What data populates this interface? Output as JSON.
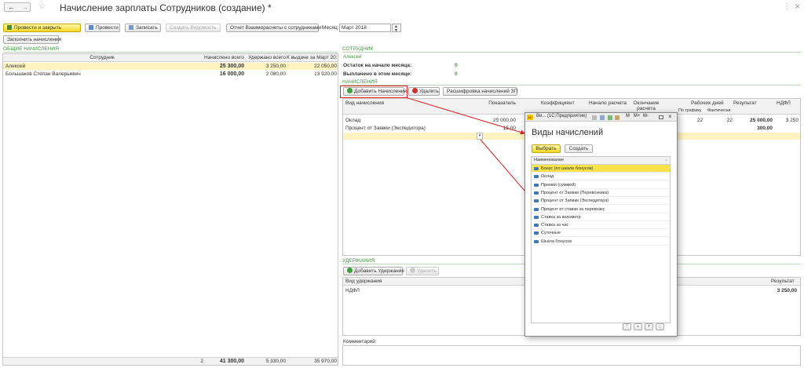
{
  "window": {
    "title": "Начисление зарплаты Сотрудников (создание) *",
    "nav_back": "←",
    "nav_forward": "→",
    "star": "☆",
    "more": "⋮",
    "close": "×"
  },
  "toolbar": {
    "post_close": "Провести и закрыть",
    "post": "Провести",
    "save": "Записать",
    "create_statement": "Создать Ведомость",
    "report_settlements": "Отчет Взаиморасчеты с сотрудниками",
    "month_label": "Месяц:",
    "month_value": "Март 2018",
    "fill_accruals": "Заполнить начисления"
  },
  "general": {
    "section_title": "ОБЩИЕ НАЧИСЛЕНИЯ",
    "columns": [
      "Сотрудник",
      "Начислено всего",
      "Удержано всего",
      "К выдаче за Март 2018"
    ],
    "rows": [
      {
        "employee": "Алексей",
        "accrued": "25 300,00",
        "withheld": "3 250,00",
        "payout": "22 050,00"
      },
      {
        "employee": "Большаков Степан Валерьевич",
        "accrued": "16 000,00",
        "withheld": "2 080,00",
        "payout": "13 920,00"
      }
    ],
    "footer": {
      "count": "2",
      "accrued": "41 300,00",
      "withheld": "5 330,00",
      "payout": "35 970,00"
    }
  },
  "employee": {
    "section_title": "СОТРУДНИК",
    "name": "Алексей",
    "balance_label": "Остаток на начало месяца:",
    "balance_value": "0",
    "paid_label": "Выплачено в этом месяце:",
    "paid_value": "0"
  },
  "accruals": {
    "section_title": "НАЧИСЛЕНИЯ",
    "add_button": "Добавить Начисление",
    "delete_button": "Удалить",
    "breakdown_button": "Расшифровка начислений ЗП",
    "columns": {
      "type": "Вид начисления",
      "indicator": "Показатель",
      "coefficient": "Коэффициент",
      "start": "Начало расчета",
      "end": "Окончание расчета",
      "workdays": "Рабочих дней",
      "by_schedule": "По графику",
      "actual": "Фактически",
      "result": "Результат",
      "ndfl": "НДФЛ"
    },
    "rows": [
      {
        "type": "Оклад",
        "indicator": "25 000,00",
        "by_schedule": "22",
        "actual": "22",
        "result": "25 000,00",
        "ndfl": "3 250"
      },
      {
        "type": "Процент от Заявки (Экспедитора)",
        "indicator": "15,00",
        "by_schedule": "",
        "actual": "",
        "result": "300,00",
        "ndfl": ""
      }
    ]
  },
  "deductions": {
    "section_title": "УДЕРЖАНИЯ",
    "add_button": "Добавить Удержание",
    "delete_button": "Удалить",
    "columns": {
      "type": "Вид удержания",
      "result": "Результат"
    },
    "rows": [
      {
        "type": "НДФЛ",
        "result": "3 250,00"
      }
    ]
  },
  "comment_label": "Комментарий:",
  "popup": {
    "title_bar": "Ви... (1С:Предприятие)",
    "tb_buttons": [
      "M",
      "M+",
      "M-"
    ],
    "heading": "Виды начислений",
    "select_button": "Выбрать",
    "create_button": "Создать",
    "column": "Наименование",
    "items": [
      "Бонус (по шкале бонусов)",
      "Оклад",
      "Премия (суммой)",
      "Процент от Заявки (Перевозчика)",
      "Процент от Заявки (Экспедитора)",
      "Процент от ставки за перевозку",
      "Ставка за километр",
      "Ставка за час",
      "Суточные",
      "Шкала бонусов"
    ],
    "selected_index": 0,
    "nav": [
      "⤒",
      "▲",
      "▼",
      "⤓"
    ]
  },
  "colors": {
    "accent_yellow": "#f9e24a",
    "section_green": "#3a9a3a",
    "selection_row": "#fdf3c0",
    "annotation_red": "#e02020"
  }
}
